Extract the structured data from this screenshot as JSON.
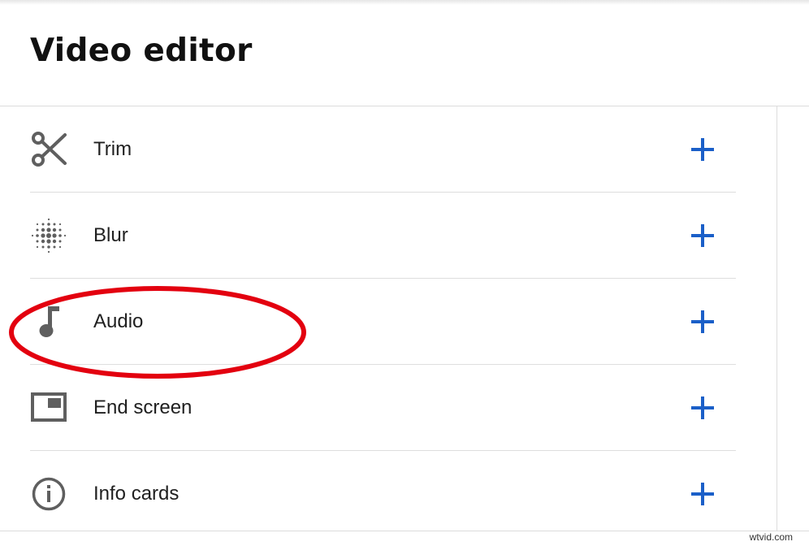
{
  "header": {
    "title": "Video editor"
  },
  "items": [
    {
      "label": "Trim",
      "icon": "scissors-icon"
    },
    {
      "label": "Blur",
      "icon": "blur-icon"
    },
    {
      "label": "Audio",
      "icon": "music-note-icon"
    },
    {
      "label": "End screen",
      "icon": "end-screen-icon"
    },
    {
      "label": "Info cards",
      "icon": "info-icon"
    }
  ],
  "add_icon": "plus-icon",
  "annotation": {
    "shape": "ellipse",
    "color": "#e3000f",
    "target": "Audio"
  },
  "watermark": "wtvid.com",
  "colors": {
    "accent": "#1a5fc8",
    "icon": "#5f5f5f",
    "text": "#202020"
  }
}
